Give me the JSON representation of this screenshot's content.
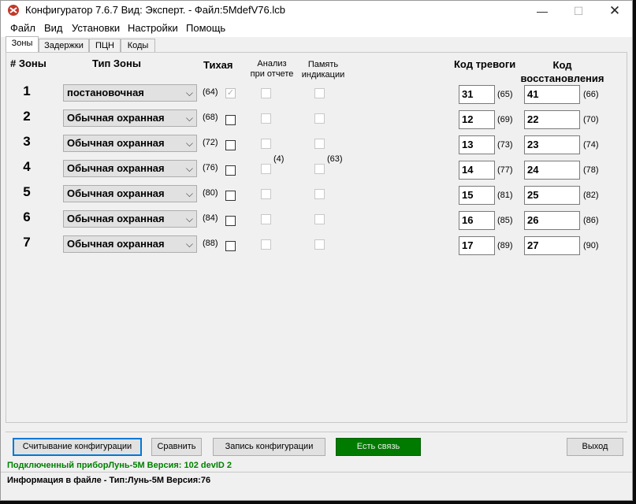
{
  "window": {
    "title": "Конфигуратор 7.6.7  Вид:  Эксперт. - Файл:5MdefV76.lcb"
  },
  "menu": [
    "Файл",
    "Вид",
    "Установки",
    "Настройки",
    "Помощь"
  ],
  "tabs": [
    "Зоны",
    "Задержки",
    "ПЦН",
    "Коды"
  ],
  "headers": {
    "zone_num": "# Зоны",
    "zone_type": "Тип Зоны",
    "silent": "Тихая",
    "analysis": "Анализ\nпри отчете",
    "memory": "Память\nиндикации",
    "alarm_code": "Код тревоги",
    "restore_code": "Код\nвосстановления"
  },
  "notes": {
    "analysis_ref": "(4)",
    "memory_ref": "(63)"
  },
  "zones": [
    {
      "num": "1",
      "type": "постановочная",
      "type_ref": "(64)",
      "alarm": "31",
      "alarm_ref": "(65)",
      "restore": "41",
      "restore_ref": "(66)"
    },
    {
      "num": "2",
      "type": "Обычная охранная",
      "type_ref": "(68)",
      "alarm": "12",
      "alarm_ref": "(69)",
      "restore": "22",
      "restore_ref": "(70)"
    },
    {
      "num": "3",
      "type": "Обычная охранная",
      "type_ref": "(72)",
      "alarm": "13",
      "alarm_ref": "(73)",
      "restore": "23",
      "restore_ref": "(74)"
    },
    {
      "num": "4",
      "type": "Обычная охранная",
      "type_ref": "(76)",
      "alarm": "14",
      "alarm_ref": "(77)",
      "restore": "24",
      "restore_ref": "(78)"
    },
    {
      "num": "5",
      "type": "Обычная охранная",
      "type_ref": "(80)",
      "alarm": "15",
      "alarm_ref": "(81)",
      "restore": "25",
      "restore_ref": "(82)"
    },
    {
      "num": "6",
      "type": "Обычная охранная",
      "type_ref": "(84)",
      "alarm": "16",
      "alarm_ref": "(85)",
      "restore": "26",
      "restore_ref": "(86)"
    },
    {
      "num": "7",
      "type": "Обычная охранная",
      "type_ref": "(88)",
      "alarm": "17",
      "alarm_ref": "(89)",
      "restore": "27",
      "restore_ref": "(90)"
    }
  ],
  "buttons": {
    "read": "Считывание конфигурации",
    "compare": "Сравнить",
    "write": "Запись конфигурации",
    "status": "Есть связь",
    "exit": "Выход"
  },
  "status": {
    "connected": "Подключенный приборЛунь-5М Версия: 102 devID 2",
    "file_info": "Информация в файле - Тип:Лунь-5М Версия:76"
  },
  "colors": {
    "status_green": "#007b00",
    "connected_text": "#008000",
    "focus_border": "#0078d7"
  }
}
